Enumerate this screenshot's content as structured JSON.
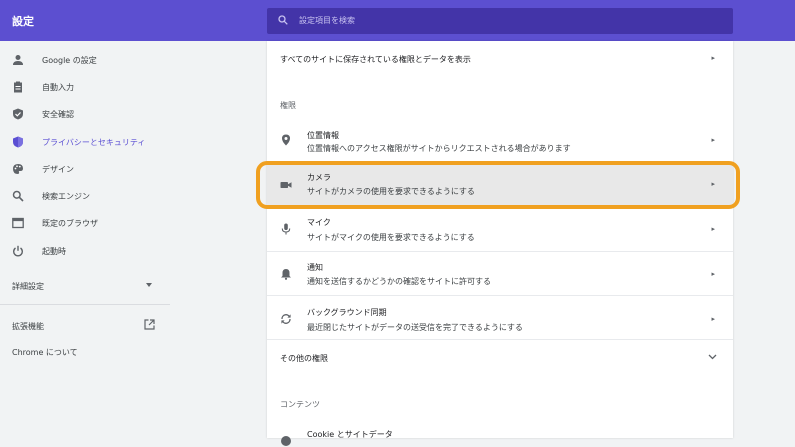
{
  "header": {
    "title": "設定",
    "search_placeholder": "設定項目を検索"
  },
  "sidebar": {
    "items": [
      {
        "label": "Google の設定"
      },
      {
        "label": "自動入力"
      },
      {
        "label": "安全確認"
      },
      {
        "label": "プライバシーとセキュリティ"
      },
      {
        "label": "デザイン"
      },
      {
        "label": "検索エンジン"
      },
      {
        "label": "既定のブラウザ"
      },
      {
        "label": "起動時"
      }
    ],
    "advanced": "詳細設定",
    "extensions": "拡張機能",
    "about": "Chrome について",
    "active_color": "#5b4fd3"
  },
  "main": {
    "all_sites": "すべてのサイトに保存されている権限とデータを表示",
    "permissions_heading": "権限",
    "permissions": [
      {
        "title": "位置情報",
        "desc": "位置情報へのアクセス権限がサイトからリクエストされる場合があります"
      },
      {
        "title": "カメラ",
        "desc": "サイトがカメラの使用を要求できるようにする"
      },
      {
        "title": "マイク",
        "desc": "サイトがマイクの使用を要求できるようにする"
      },
      {
        "title": "通知",
        "desc": "通知を送信するかどうかの確認をサイトに許可する"
      },
      {
        "title": "バックグラウンド同期",
        "desc": "最近閉じたサイトがデータの送受信を完了できるようにする"
      }
    ],
    "more_permissions": "その他の権限",
    "content_heading": "コンテンツ",
    "cookie_row": "Cookie とサイトデータ"
  }
}
